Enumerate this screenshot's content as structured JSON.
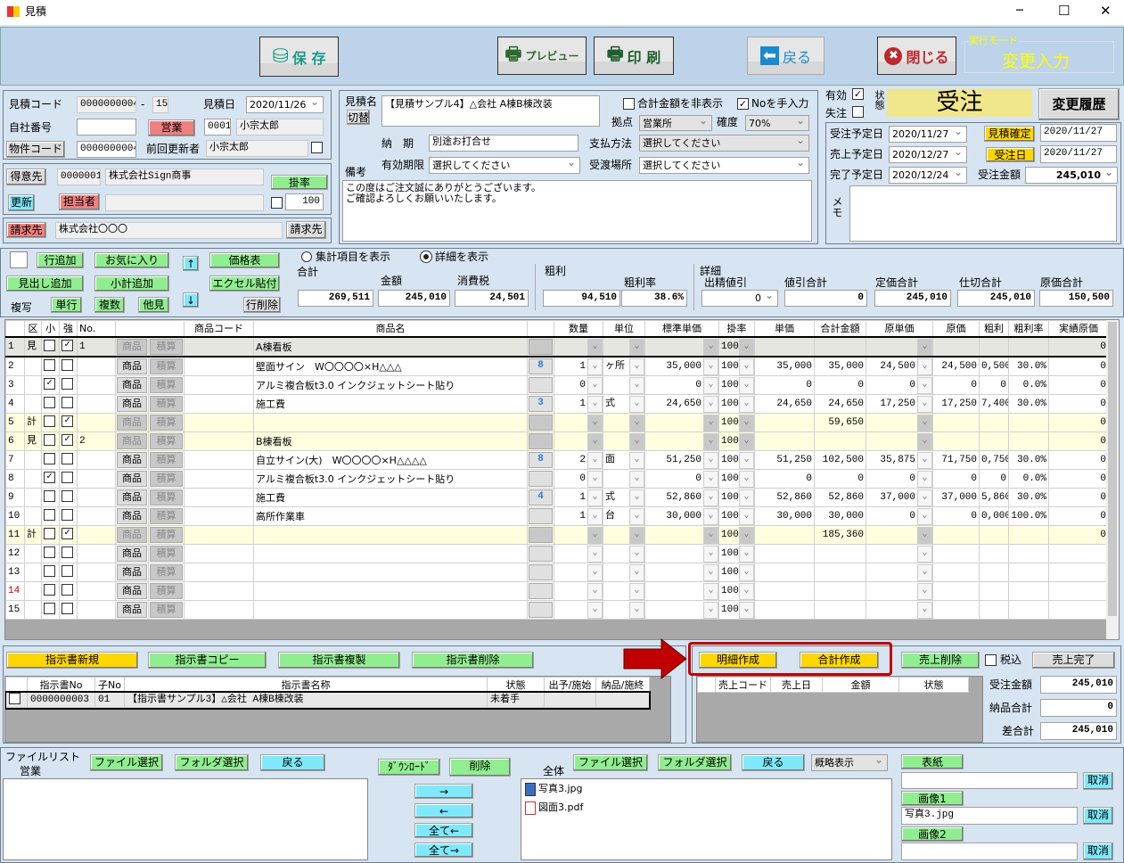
{
  "window": {
    "title": "見積",
    "minimize": "─",
    "maximize": "☐",
    "close": "✕"
  },
  "toolbar": {
    "save": "保 存",
    "preview": "プレビュー",
    "print": "印 刷",
    "back": "戻る",
    "close": "閉じる",
    "mode_label": "実行モード",
    "mode_value": "変更入力"
  },
  "header": {
    "est_code_label": "見積コード",
    "est_code": "0000000004",
    "dash": "-",
    "branch": "15",
    "est_date_label": "見積日",
    "est_date": "2020/11/26",
    "company_no_label": "自社番号",
    "company_no": "",
    "sales_btn": "営業",
    "staff_code": "0001",
    "staff_name": "小宗太郎",
    "property_btn": "物件コード",
    "property_code": "0000000004",
    "last_updater_label": "前回更新者",
    "last_updater": "小宗太郎"
  },
  "customer": {
    "btn": "得意先",
    "code": "0000001",
    "name": "株式会社Sign商事",
    "rate_btn": "掛率",
    "rate": "100",
    "update_btn": "更新",
    "person_btn": "担当者",
    "person": ""
  },
  "billing": {
    "btn": "請求先",
    "name": "株式会社〇〇〇",
    "btn2": "請求先"
  },
  "estimate": {
    "name_label": "見積名",
    "switch_btn": "切替",
    "name": "【見積サンプル4】△会社 A棟B棟改装",
    "hide_total": "合計金額を非表示",
    "no_manual": "Noを手入力",
    "base_label": "拠点",
    "base": "営業所",
    "certainty_label": "確度",
    "certainty": "70%",
    "delivery_label": "納　期",
    "delivery": "別途お打合せ",
    "payment_label": "支払方法",
    "payment": "選択してください",
    "validity_label": "有効期限",
    "validity": "選択してください",
    "place_label": "受渡場所",
    "place": "選択してください",
    "remarks_label": "備考",
    "remarks": "この度はご注文誠にありがとうございます。\nご確認よろしくお願いいたします。"
  },
  "status": {
    "valid_label": "有効",
    "lost_label": "失注",
    "state_label": "状態",
    "state": "受注",
    "history_btn": "変更履歴",
    "state_color": "#f0e68c"
  },
  "dates": {
    "order_plan_label": "受注予定日",
    "order_plan": "2020/11/27",
    "est_confirm_btn": "見積確定",
    "est_confirm": "2020/11/27",
    "sales_plan_label": "売上予定日",
    "sales_plan": "2020/12/27",
    "order_date_btn": "受注日",
    "order_date": "2020/11/27",
    "complete_label": "完了予定日",
    "complete": "2020/12/24",
    "order_amount_label": "受注金額",
    "order_amount": "245,010",
    "memo_label": "メモ",
    "memo": ""
  },
  "rowtools": {
    "row_add": "行追加",
    "favorite": "お気に入り",
    "up": "↑",
    "price_table": "価格表",
    "heading_add": "見出し追加",
    "subtotal_add": "小計追加",
    "down": "↓",
    "excel": "エクセル貼付",
    "copy_label": "複写",
    "single": "単行",
    "multi": "複数",
    "other": "他見",
    "row_delete": "行削除",
    "radio_summary": "集計項目を表示",
    "radio_detail": "詳細を表示"
  },
  "totals": {
    "group_total": "合計",
    "amount_label": "金額",
    "tax_label": "消費税",
    "total": "269,511",
    "amount": "245,010",
    "tax": "24,501",
    "gross_group": "粗利",
    "gross": "94,510",
    "gross_rate_label": "粗利率",
    "gross_rate": "38.6%",
    "detail_group": "詳細",
    "discount_label": "出精値引",
    "discount": "0",
    "discount_total_label": "値引合計",
    "discount_total": "0",
    "list_total_label": "定価合計",
    "list_total": "245,010",
    "cut_total_label": "仕切合計",
    "cut_total": "245,010",
    "cost_total_label": "原価合計",
    "cost_total": "150,500"
  },
  "grid": {
    "headers": {
      "ku": "区",
      "small": "小",
      "strong": "強",
      "no": "No.",
      "code": "商品コード",
      "name": "商品名",
      "qty": "数量",
      "unit": "単位",
      "std": "標準単価",
      "rate": "掛率",
      "price": "単価",
      "total": "合計金額",
      "cost_unit": "原単価",
      "cost": "原価",
      "gross": "粗利",
      "gross_rate": "粗利率",
      "actual": "実績原価"
    },
    "product_btn": "商品",
    "calc_btn": "積算",
    "rows": [
      {
        "n": "1",
        "kind": "見",
        "small": false,
        "strong": true,
        "no": "1",
        "name": "A棟看板",
        "link": "",
        "qty": "",
        "unit": "",
        "std": "",
        "rate": "100",
        "price": "",
        "total": "",
        "cost_unit": "",
        "cost": "",
        "gross": "",
        "gross_rate": "",
        "actual": "0",
        "type": "selected"
      },
      {
        "n": "2",
        "kind": "",
        "small": false,
        "strong": false,
        "no": "",
        "name": "壁面サイン　W〇〇〇〇×H△△△",
        "link": "8",
        "qty": "1",
        "unit": "ヶ所",
        "std": "35,000",
        "rate": "100",
        "price": "35,000",
        "total": "35,000",
        "cost_unit": "24,500",
        "cost": "24,500",
        "gross": "0,500",
        "gross_rate": "30.0%",
        "actual": "0",
        "type": "normal"
      },
      {
        "n": "3",
        "kind": "",
        "small": true,
        "strong": false,
        "no": "",
        "name": "アルミ複合板t3.0 インクジェットシート貼り",
        "link": "",
        "qty": "0",
        "unit": "",
        "std": "0",
        "rate": "100",
        "price": "0",
        "total": "0",
        "cost_unit": "0",
        "cost": "0",
        "gross": "0",
        "gross_rate": "0.0%",
        "actual": "0",
        "type": "normal"
      },
      {
        "n": "4",
        "kind": "",
        "small": false,
        "strong": false,
        "no": "",
        "name": "施工費",
        "link": "3",
        "qty": "1",
        "unit": "式",
        "std": "24,650",
        "rate": "100",
        "price": "24,650",
        "total": "24,650",
        "cost_unit": "17,250",
        "cost": "17,250",
        "gross": "7,400",
        "gross_rate": "30.0%",
        "actual": "0",
        "type": "normal"
      },
      {
        "n": "5",
        "kind": "計",
        "small": false,
        "strong": true,
        "no": "",
        "name": "",
        "link": "",
        "qty": "",
        "unit": "",
        "std": "",
        "rate": "100",
        "price": "",
        "total": "59,650",
        "cost_unit": "",
        "cost": "",
        "gross": "",
        "gross_rate": "",
        "actual": "0",
        "type": "summary"
      },
      {
        "n": "6",
        "kind": "見",
        "small": false,
        "strong": true,
        "no": "2",
        "name": "B棟看板",
        "link": "",
        "qty": "",
        "unit": "",
        "std": "",
        "rate": "100",
        "price": "",
        "total": "",
        "cost_unit": "",
        "cost": "",
        "gross": "",
        "gross_rate": "",
        "actual": "0",
        "type": "summary"
      },
      {
        "n": "7",
        "kind": "",
        "small": false,
        "strong": false,
        "no": "",
        "name": "自立サイン(大)　W〇〇〇〇×H△△△△",
        "link": "8",
        "qty": "2",
        "unit": "面",
        "std": "51,250",
        "rate": "100",
        "price": "51,250",
        "total": "102,500",
        "cost_unit": "35,875",
        "cost": "71,750",
        "gross": "0,750",
        "gross_rate": "30.0%",
        "actual": "0",
        "type": "normal"
      },
      {
        "n": "8",
        "kind": "",
        "small": true,
        "strong": false,
        "no": "",
        "name": "アルミ複合板t3.0 インクジェットシート貼り",
        "link": "",
        "qty": "0",
        "unit": "",
        "std": "0",
        "rate": "100",
        "price": "0",
        "total": "0",
        "cost_unit": "0",
        "cost": "0",
        "gross": "0",
        "gross_rate": "0.0%",
        "actual": "0",
        "type": "normal"
      },
      {
        "n": "9",
        "kind": "",
        "small": false,
        "strong": false,
        "no": "",
        "name": "施工費",
        "link": "4",
        "qty": "1",
        "unit": "式",
        "std": "52,860",
        "rate": "100",
        "price": "52,860",
        "total": "52,860",
        "cost_unit": "37,000",
        "cost": "37,000",
        "gross": "5,860",
        "gross_rate": "30.0%",
        "actual": "0",
        "type": "normal"
      },
      {
        "n": "10",
        "kind": "",
        "small": false,
        "strong": false,
        "no": "",
        "name": "高所作業車",
        "link": "",
        "qty": "1",
        "unit": "台",
        "std": "30,000",
        "rate": "100",
        "price": "30,000",
        "total": "30,000",
        "cost_unit": "0",
        "cost": "0",
        "gross": "0,000",
        "gross_rate": "100.0%",
        "actual": "0",
        "type": "normal"
      },
      {
        "n": "11",
        "kind": "計",
        "small": false,
        "strong": true,
        "no": "",
        "name": "",
        "link": "",
        "qty": "",
        "unit": "",
        "std": "",
        "rate": "100",
        "price": "",
        "total": "185,360",
        "cost_unit": "",
        "cost": "",
        "gross": "",
        "gross_rate": "",
        "actual": "0",
        "type": "summary"
      },
      {
        "n": "12",
        "kind": "",
        "small": false,
        "strong": false,
        "no": "",
        "name": "",
        "link": "",
        "qty": "",
        "unit": "",
        "std": "",
        "rate": "100",
        "price": "",
        "total": "",
        "cost_unit": "",
        "cost": "",
        "gross": "",
        "gross_rate": "",
        "actual": "",
        "type": "normal"
      },
      {
        "n": "13",
        "kind": "",
        "small": false,
        "strong": false,
        "no": "",
        "name": "",
        "link": "",
        "qty": "",
        "unit": "",
        "std": "",
        "rate": "100",
        "price": "",
        "total": "",
        "cost_unit": "",
        "cost": "",
        "gross": "",
        "gross_rate": "",
        "actual": "",
        "type": "normal"
      },
      {
        "n": "14",
        "kind": "",
        "small": false,
        "strong": false,
        "no": "",
        "name": "",
        "link": "",
        "qty": "",
        "unit": "",
        "std": "",
        "rate": "100",
        "price": "",
        "total": "",
        "cost_unit": "",
        "cost": "",
        "gross": "",
        "gross_rate": "",
        "actual": "",
        "type": "normal",
        "num_color": "#d00000"
      },
      {
        "n": "15",
        "kind": "",
        "small": false,
        "strong": false,
        "no": "",
        "name": "",
        "link": "",
        "qty": "",
        "unit": "",
        "std": "",
        "rate": "100",
        "price": "",
        "total": "",
        "cost_unit": "",
        "cost": "",
        "gross": "",
        "gross_rate": "",
        "actual": "",
        "type": "normal"
      }
    ]
  },
  "instructions": {
    "new": "指示書新規",
    "copy": "指示書コピー",
    "dup": "指示書複製",
    "delete": "指示書削除",
    "columns": [
      "指示書No",
      "子No",
      "指示書名称",
      "状態",
      "出予/施始",
      "納品/施終"
    ],
    "rows": [
      {
        "no": "0000000003",
        "child": "01",
        "name": "【指示書サンプル3】△会社 A棟B棟改装",
        "state": "未着手",
        "start": "",
        "end": ""
      }
    ]
  },
  "sales": {
    "detail_create": "明細作成",
    "total_create": "合計作成",
    "delete": "売上削除",
    "tax_incl": "税込",
    "complete": "売上完了",
    "columns": [
      "売上コード",
      "売上日",
      "金額",
      "状態"
    ],
    "order_amount_label": "受注金額",
    "order_amount": "245,010",
    "delivered_label": "納品合計",
    "delivered": "0",
    "diff_label": "差合計",
    "diff": "245,010",
    "highlight_color": "#c00000"
  },
  "files": {
    "list_label": "ファイルリスト",
    "sales_label": "営業",
    "file_select": "ファイル選択",
    "folder_select": "フォルダ選択",
    "back": "戻る",
    "download": "ﾀﾞｳﾝﾛｰﾄﾞ",
    "delete": "削除",
    "right": "→",
    "left": "←",
    "all_left": "全て←",
    "all_right": "全て→",
    "all_label": "全体",
    "view_mode": "概略表示",
    "items": [
      {
        "name": "写真3.jpg",
        "icon": "image-file-icon"
      },
      {
        "name": "図面3.pdf",
        "icon": "pdf-file-icon"
      }
    ],
    "cover": "表紙",
    "cover_value": "",
    "cancel": "取消",
    "image1": "画像1",
    "image1_value": "写真3.jpg",
    "image2": "画像2",
    "image2_value": ""
  }
}
